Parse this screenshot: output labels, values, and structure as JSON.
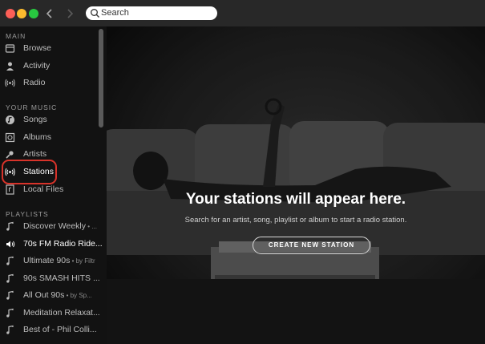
{
  "search": {
    "placeholder": "Search"
  },
  "sidebar": {
    "main_title": "MAIN",
    "main_items": [
      {
        "label": "Browse",
        "icon": "browse-icon"
      },
      {
        "label": "Activity",
        "icon": "activity-icon"
      },
      {
        "label": "Radio",
        "icon": "radio-icon"
      }
    ],
    "music_title": "YOUR MUSIC",
    "music_items": [
      {
        "label": "Songs",
        "icon": "song-icon"
      },
      {
        "label": "Albums",
        "icon": "album-icon"
      },
      {
        "label": "Artists",
        "icon": "artist-icon"
      },
      {
        "label": "Stations",
        "icon": "station-icon"
      },
      {
        "label": "Local Files",
        "icon": "local-files-icon"
      }
    ],
    "playlists_title": "PLAYLISTS",
    "playlists": [
      {
        "label": "Discover Weekly",
        "sub": " • ..."
      },
      {
        "label": "70s FM Radio Ride...",
        "sub": ""
      },
      {
        "label": "Ultimate 90s",
        "sub": " • by Filtr"
      },
      {
        "label": "90s SMASH HITS ...",
        "sub": ""
      },
      {
        "label": "All Out 90s",
        "sub": " • by Sp..."
      },
      {
        "label": "Meditation Relaxat...",
        "sub": ""
      },
      {
        "label": "Best of - Phil Colli...",
        "sub": ""
      }
    ]
  },
  "main": {
    "headline": "Your stations will appear here.",
    "subline": "Search for an artist, song, playlist or album to start a radio station.",
    "cta_label": "CREATE NEW STATION"
  },
  "colors": {
    "titlebar": "#282828",
    "sidebar": "#121212",
    "highlight_ring": "#d8332a",
    "close": "#fc5f57",
    "minimize": "#fdbc2e",
    "zoom": "#28c840"
  }
}
